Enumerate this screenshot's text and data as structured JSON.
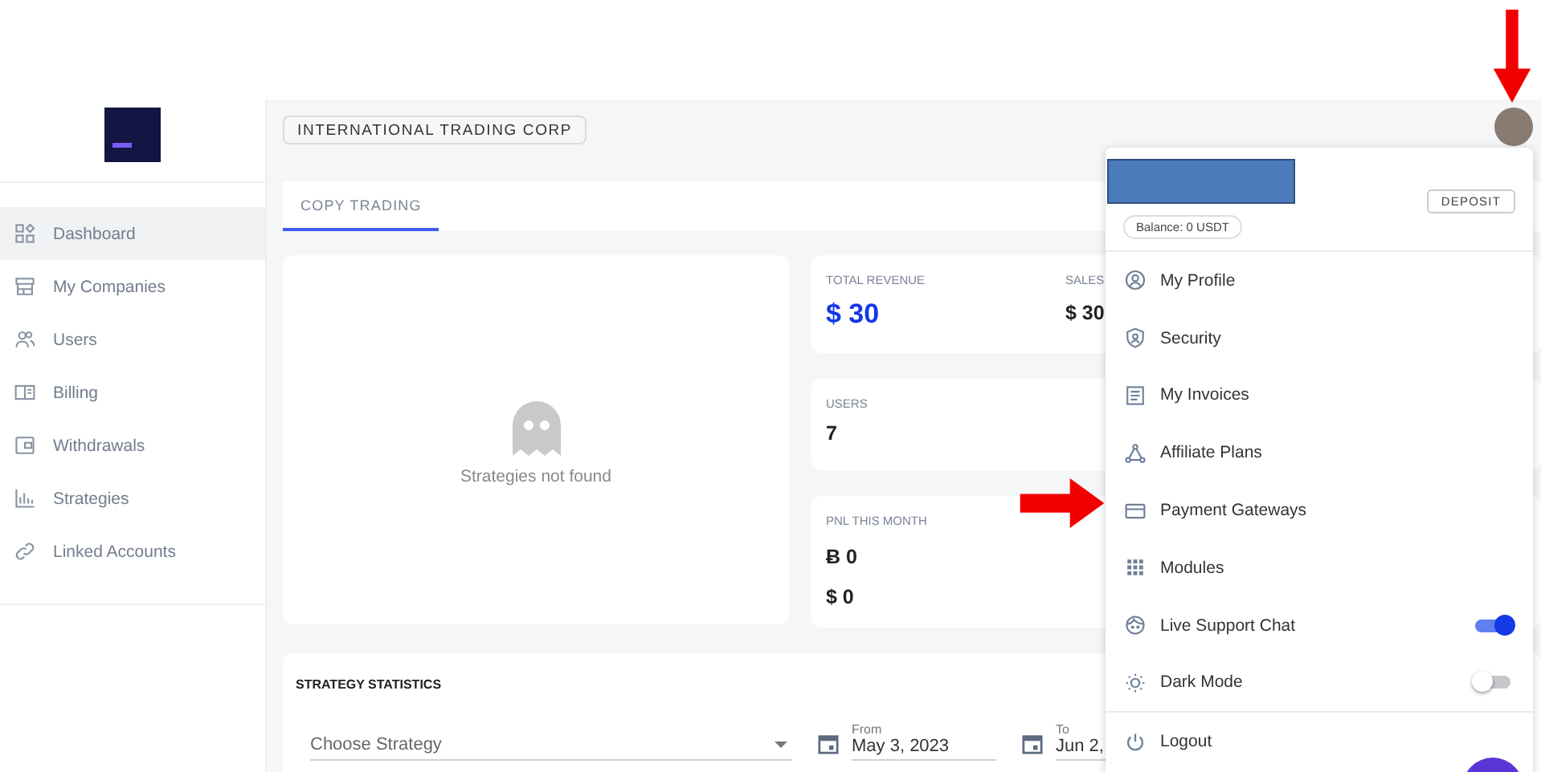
{
  "sidebar": {
    "items": [
      {
        "label": "Dashboard",
        "selected": true
      },
      {
        "label": "My Companies",
        "selected": false
      },
      {
        "label": "Users",
        "selected": false
      },
      {
        "label": "Billing",
        "selected": false
      },
      {
        "label": "Withdrawals",
        "selected": false
      },
      {
        "label": "Strategies",
        "selected": false
      },
      {
        "label": "Linked Accounts",
        "selected": false
      }
    ]
  },
  "company_button": "INTERNATIONAL TRADING CORP",
  "tabs": [
    {
      "label": "COPY TRADING",
      "selected": true
    }
  ],
  "empty_state": {
    "text": "Strategies not found"
  },
  "stats": [
    {
      "label": "TOTAL REVENUE",
      "value": "$ 30",
      "label_2": "SALES",
      "value_2": "$ 30"
    },
    {
      "label": "USERS",
      "value": "7"
    },
    {
      "label": "PNL THIS MONTH",
      "value": "Ƀ 0",
      "value_2": "$ 0"
    }
  ],
  "strategy_statistics": {
    "title": "STRATEGY STATISTICS",
    "select_placeholder": "Choose Strategy",
    "from": {
      "label": "From",
      "value": "May 3, 2023"
    },
    "to": {
      "label": "To",
      "value": "Jun 2,"
    }
  },
  "user_menu": {
    "deposit": "DEPOSIT",
    "balance": "Balance: 0 USDT",
    "items": [
      {
        "kind": "link",
        "label": "My Profile",
        "divider": false
      },
      {
        "kind": "link",
        "label": "Security",
        "divider": false
      },
      {
        "kind": "link",
        "label": "My Invoices",
        "divider": false
      },
      {
        "kind": "link",
        "label": "Affiliate Plans",
        "divider": false
      },
      {
        "kind": "link",
        "label": "Payment Gateways",
        "divider": false
      },
      {
        "kind": "link",
        "label": "Modules",
        "divider": false
      },
      {
        "kind": "toggle",
        "label": "Live Support Chat",
        "on": true,
        "divider": false
      },
      {
        "kind": "toggle",
        "label": "Dark Mode",
        "on": false,
        "divider": false
      },
      {
        "kind": "link",
        "label": "Logout",
        "divider": true
      }
    ]
  }
}
